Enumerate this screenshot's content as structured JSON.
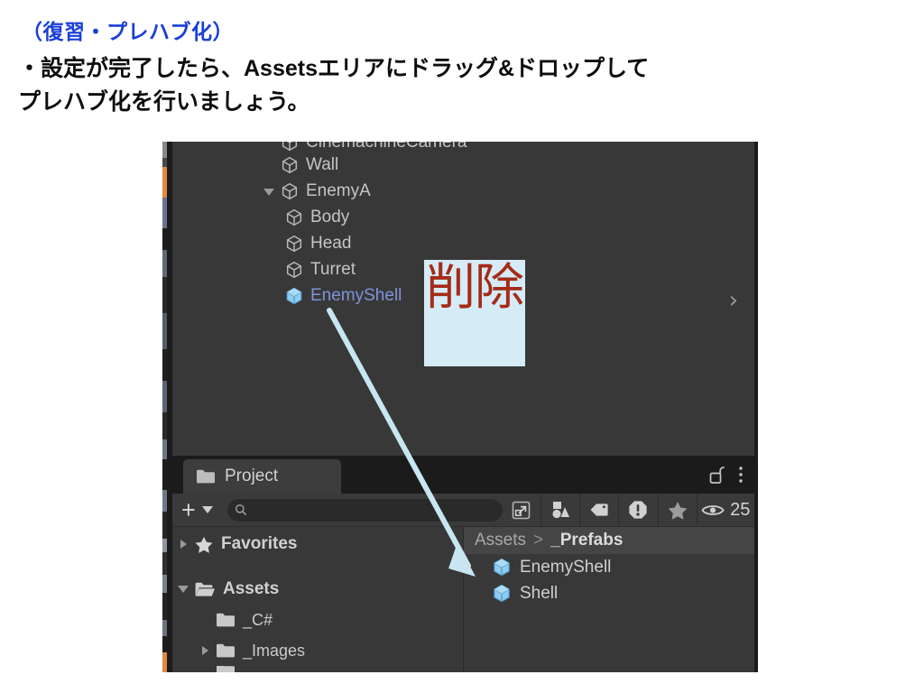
{
  "slide": {
    "heading": "（復習・プレハブ化）",
    "body_line1": "・設定が完了したら、Assetsエリアにドラッグ&ドロップして",
    "body_line2": "プレハブ化を行いましょう。",
    "heading_color": "#1a3fd6",
    "body_color": "#0d0d0d"
  },
  "annotation": {
    "label": "削除",
    "box_fill": "#d5ecf7",
    "text_color": "#a62b18",
    "arrow_color": "#c7e6f2",
    "arrow_from": "EnemyShell",
    "arrow_to": "Assets > _Prefabs"
  },
  "hierarchy": {
    "rows": [
      {
        "label": "CinemachineCamera",
        "indent": 1,
        "twisty": "none",
        "icon": "cube-outline-icon",
        "selected": false,
        "clipped": true
      },
      {
        "label": "Wall",
        "indent": 1,
        "twisty": "none",
        "icon": "cube-outline-icon",
        "selected": false,
        "clipped": false
      },
      {
        "label": "EnemyA",
        "indent": 1,
        "twisty": "open",
        "icon": "cube-outline-icon",
        "selected": false,
        "clipped": false
      },
      {
        "label": "Body",
        "indent": 2,
        "twisty": "none",
        "icon": "cube-outline-icon",
        "selected": false,
        "clipped": false
      },
      {
        "label": "Head",
        "indent": 2,
        "twisty": "none",
        "icon": "cube-outline-icon",
        "selected": false,
        "clipped": false
      },
      {
        "label": "Turret",
        "indent": 2,
        "twisty": "none",
        "icon": "cube-outline-icon",
        "selected": false,
        "clipped": false
      },
      {
        "label": "EnemyShell",
        "indent": 2,
        "twisty": "none",
        "icon": "prefab-cube-icon",
        "selected": true,
        "clipped": false
      }
    ],
    "overflow_chevron": "›",
    "selected_label_color": "#7e93dc",
    "prefab_icon_color": "#71b8e8"
  },
  "project": {
    "tab_label": "Project",
    "tab_icon": "folder-icon",
    "lock_icon": "unlock-icon",
    "menu_icon": "kebab-menu-icon",
    "toolbar": {
      "create_label": "+",
      "create_dropdown_icon": "chevron-down-icon",
      "search_icon": "search-icon",
      "search_value": "",
      "search_placeholder": "",
      "expand_icon": "open-in-new-icon",
      "filters": [
        {
          "name": "shape-filter-icon"
        },
        {
          "name": "label-filter-icon"
        },
        {
          "name": "warning-filter-icon"
        },
        {
          "name": "favorite-filter-icon"
        }
      ],
      "eye_icon": "eye-icon",
      "eye_count": "25"
    },
    "tree": [
      {
        "label": "Favorites",
        "twisty": "closed",
        "icon": "star-icon",
        "indent": 0,
        "bold": true
      },
      {
        "label": "Assets",
        "twisty": "open",
        "icon": "folder-open-icon",
        "indent": 0,
        "bold": true
      },
      {
        "label": "_C#",
        "twisty": "none",
        "icon": "folder-icon",
        "indent": 1,
        "bold": false
      },
      {
        "label": "_Images",
        "twisty": "closed",
        "icon": "folder-icon",
        "indent": 1,
        "bold": false
      }
    ],
    "breadcrumb": {
      "root": "Assets",
      "separator": ">",
      "current": "_Prefabs"
    },
    "items": [
      {
        "label": "EnemyShell",
        "icon": "prefab-cube-icon"
      },
      {
        "label": "Shell",
        "icon": "prefab-cube-icon"
      }
    ]
  }
}
